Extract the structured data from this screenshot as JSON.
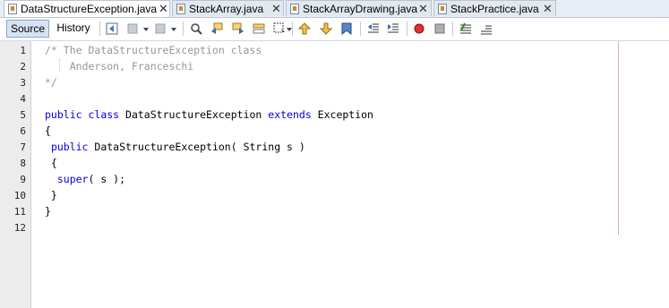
{
  "tabs": [
    {
      "label": "DataStructureException.java",
      "close": "✕",
      "active": true
    },
    {
      "label": "StackArray.java",
      "close": "✕",
      "active": false
    },
    {
      "label": "StackArrayDrawing.java",
      "close": "✕",
      "active": false
    },
    {
      "label": "StackPractice.java",
      "close": "✕",
      "active": false
    }
  ],
  "toolbar": {
    "source_label": "Source",
    "history_label": "History",
    "icons": [
      "back-icon",
      "forward-dropdown-icon",
      "history-dropdown-icon",
      "find-icon",
      "find-previous-icon",
      "find-next-icon",
      "find-selection-icon",
      "select-icon",
      "previous-bookmark-icon",
      "next-bookmark-icon",
      "toggle-bookmark-icon",
      "shift-left-icon",
      "shift-right-icon",
      "record-macro-icon",
      "stop-macro-icon",
      "comment-icon",
      "uncomment-icon"
    ]
  },
  "editor": {
    "line_numbers": [
      "1",
      "2",
      "3",
      "4",
      "5",
      "6",
      "7",
      "8",
      "9",
      "10",
      "11",
      "12"
    ],
    "lines": [
      {
        "segments": [
          {
            "text": "/* The DataStructureException class",
            "type": "comment"
          }
        ]
      },
      {
        "segments": [
          {
            "text": "    Anderson, Franceschi",
            "type": "comment"
          }
        ]
      },
      {
        "segments": [
          {
            "text": "*/",
            "type": "comment"
          }
        ]
      },
      {
        "segments": []
      },
      {
        "segments": [
          {
            "text": "public",
            "type": "keyword"
          },
          {
            "text": " ",
            "type": "plain"
          },
          {
            "text": "class",
            "type": "keyword"
          },
          {
            "text": " DataStructureException ",
            "type": "plain"
          },
          {
            "text": "extends",
            "type": "keyword"
          },
          {
            "text": " Exception",
            "type": "plain"
          }
        ]
      },
      {
        "segments": [
          {
            "text": "{",
            "type": "plain"
          }
        ]
      },
      {
        "segments": [
          {
            "text": " ",
            "type": "plain"
          },
          {
            "text": "public",
            "type": "keyword"
          },
          {
            "text": " DataStructureException( String s )",
            "type": "plain"
          }
        ]
      },
      {
        "segments": [
          {
            "text": " {",
            "type": "plain"
          }
        ]
      },
      {
        "segments": [
          {
            "text": "  ",
            "type": "plain"
          },
          {
            "text": "super",
            "type": "keyword"
          },
          {
            "text": "( s );",
            "type": "plain"
          }
        ]
      },
      {
        "segments": [
          {
            "text": " }",
            "type": "plain"
          }
        ]
      },
      {
        "segments": [
          {
            "text": "}",
            "type": "plain"
          }
        ]
      },
      {
        "segments": []
      }
    ]
  },
  "colors": {
    "keyword": "#0000e6",
    "comment": "#969696",
    "text": "#000000",
    "margin_line": "#e8a8a8"
  }
}
